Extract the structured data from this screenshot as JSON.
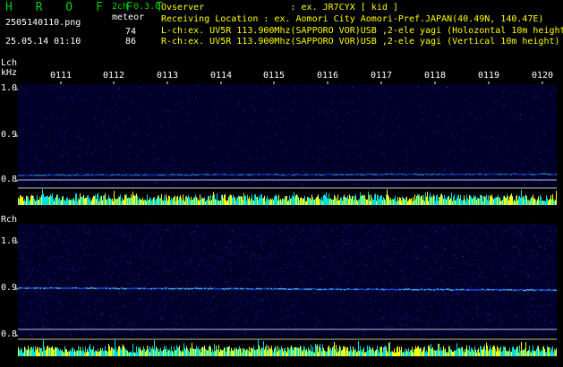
{
  "header": {
    "app_title": "H R O F F T",
    "version": "2ch 0.3.0",
    "filename": "2505140110.png",
    "meteor_label": "meteor",
    "timestamp": "25.05.14 01:10",
    "count_l": "74",
    "count_r": "86"
  },
  "info": {
    "observer": "Ovserver                : ex. JR7CYX [ kid ]",
    "location": "Receiving Location : ex. Aomori City Aomori-Pref.JAPAN(40.49N, 140.47E)",
    "lch": "L-ch:ex. UV5R 113.900Mhz(SAPPORO VOR)USB ,2-ele yagi (Holozontal 10m height)",
    "rch": "R-ch:ex. UV5R 113.900Mhz(SAPPORO VOR)USB ,2-ele yagi (Vertical 10m height)"
  },
  "time_ticks": [
    "0111",
    "0112",
    "0113",
    "0114",
    "0115",
    "0116",
    "0117",
    "0118",
    "0119",
    "0120"
  ],
  "lch": {
    "label": "Lch",
    "unit": "kHz",
    "y_ticks": [
      "1.0",
      "0.9",
      "0.8"
    ]
  },
  "rch": {
    "label": "Rch",
    "y_ticks": [
      "1.0",
      "0.9",
      "0.8"
    ]
  },
  "colors": {
    "app_green": "#00d000",
    "spectrum_bg": "#00002a",
    "noise": "#2030c0",
    "signal": "#40c0ff",
    "meter_cyan": "#00e0e0",
    "meter_yellow": "#ffff00"
  }
}
